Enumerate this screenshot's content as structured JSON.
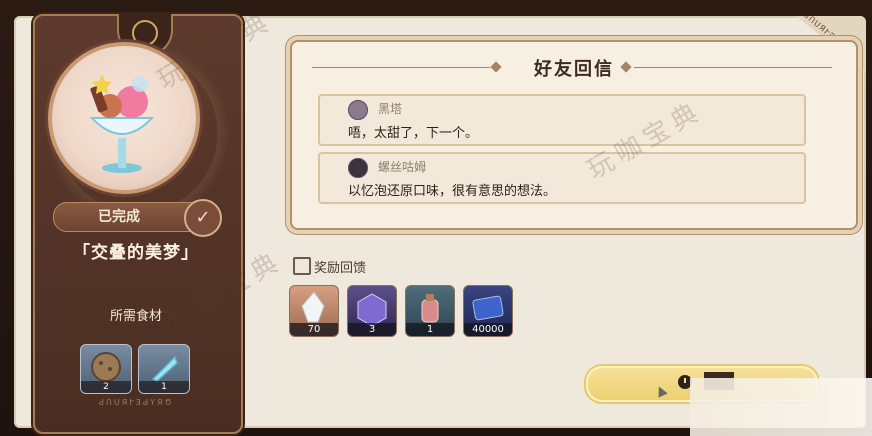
{
  "dish": {
    "status": "已完成",
    "name": "「交叠的美梦」",
    "ingredients_title": "所需食材",
    "ingredients": [
      {
        "icon": "nut-icon",
        "qty": "2"
      },
      {
        "icon": "feather-icon",
        "qty": "1"
      }
    ],
    "footer_text": "ԀՈՍЯՒƎԀҮЯԾ"
  },
  "replies": {
    "title": "好友回信",
    "messages": [
      {
        "sender": "黑塔",
        "body": "唔，太甜了，下一个。"
      },
      {
        "sender": "螺丝咕姆",
        "body": "以忆泡还原口味，很有意思的想法。"
      }
    ]
  },
  "rewards": {
    "header": "奖励回馈",
    "items": [
      {
        "icon": "crystal-icon",
        "qty": "70"
      },
      {
        "icon": "purple-cube-icon",
        "qty": "3"
      },
      {
        "icon": "potion-icon",
        "qty": "1"
      },
      {
        "icon": "credit-card-icon",
        "qty": "40000"
      }
    ]
  },
  "corner_tag": "ԀՈՍЯՒƎԀҮЯԾ",
  "watermark": "玩咖宝典",
  "colors": {
    "card_bg": "#5d3a2d",
    "panel_bg": "#efe9dd",
    "button": "#f6e19b",
    "accent_border": "#b58f68"
  }
}
